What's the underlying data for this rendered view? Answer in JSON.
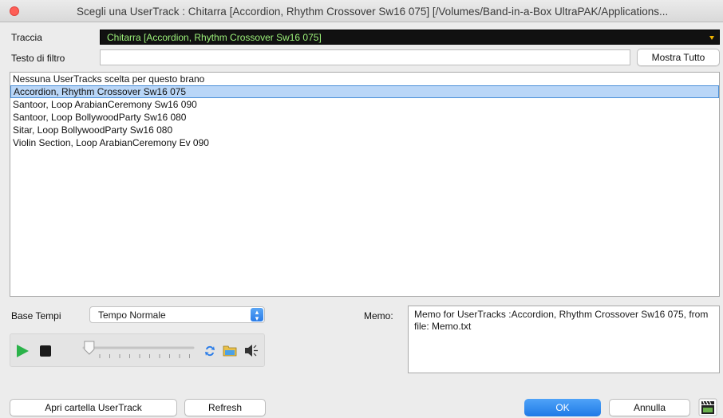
{
  "window": {
    "title": "Scegli una UserTrack : Chitarra    [Accordion, Rhythm Crossover Sw16 075]  [/Volumes/Band-in-a-Box UltraPAK/Applications..."
  },
  "track": {
    "label": "Traccia",
    "value": "Chitarra   [Accordion, Rhythm Crossover Sw16 075]"
  },
  "filter": {
    "label": "Testo di filtro",
    "value": "",
    "show_all_label": "Mostra Tutto"
  },
  "usertracks": {
    "items": [
      "Nessuna UserTracks scelta per questo brano",
      "Accordion, Rhythm Crossover Sw16 075",
      "Santoor, Loop ArabianCeremony Sw16 090",
      "Santoor, Loop BollywoodParty Sw16 080",
      "Sitar, Loop BollywoodParty Sw16 080",
      "Violin Section, Loop ArabianCeremony Ev 090"
    ],
    "selected_index": 1
  },
  "tempo": {
    "label": "Base Tempi",
    "value": "Tempo Normale"
  },
  "memo": {
    "label": "Memo:",
    "text": "Memo for UserTracks :Accordion, Rhythm Crossover Sw16 075, from file: Memo.txt"
  },
  "transport": {
    "icons": [
      "play-icon",
      "stop-icon",
      "loop-icon",
      "folder-icon",
      "speaker-icon"
    ],
    "volume_level": 0.05
  },
  "footer": {
    "open_folder_label": "Apri cartella UserTrack",
    "refresh_label": "Refresh",
    "ok_label": "OK",
    "cancel_label": "Annulla",
    "help_icon": "movie-clapper-icon"
  },
  "colors": {
    "track_text": "#9df27a",
    "selection": "#b9d6f7",
    "accent": "#2a7ce8"
  }
}
